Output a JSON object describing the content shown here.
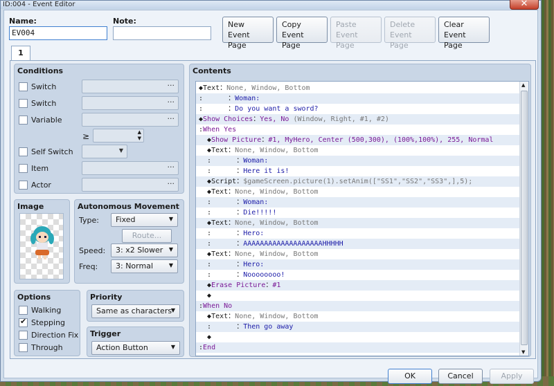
{
  "window": {
    "title": "ID:004 - Event Editor",
    "close": "✕"
  },
  "header": {
    "name_label": "Name:",
    "name_value": "EV004",
    "note_label": "Note:",
    "note_value": ""
  },
  "toolbar": [
    {
      "line1": "New",
      "line2": "Event Page"
    },
    {
      "line1": "Copy",
      "line2": "Event Page"
    },
    {
      "line1": "Paste",
      "line2": "Event Page"
    },
    {
      "line1": "Delete",
      "line2": "Event Page"
    },
    {
      "line1": "Clear",
      "line2": "Event Page"
    }
  ],
  "tab": {
    "label": "1"
  },
  "conditions": {
    "title": "Conditions",
    "items": [
      {
        "label": "Switch"
      },
      {
        "label": "Switch"
      },
      {
        "label": "Variable"
      },
      {
        "label": "Self Switch"
      },
      {
        "label": "Item"
      },
      {
        "label": "Actor"
      }
    ],
    "ge_symbol": "≥",
    "dots": "···"
  },
  "image": {
    "title": "Image"
  },
  "autonomous": {
    "title": "Autonomous Movement",
    "type_label": "Type:",
    "type_value": "Fixed",
    "route_label": "Route...",
    "speed_label": "Speed:",
    "speed_value": "3: x2 Slower",
    "freq_label": "Freq:",
    "freq_value": "3: Normal"
  },
  "options": {
    "title": "Options",
    "items": [
      {
        "label": "Walking",
        "checked": false
      },
      {
        "label": "Stepping",
        "checked": true
      },
      {
        "label": "Direction Fix",
        "checked": false
      },
      {
        "label": "Through",
        "checked": false
      }
    ]
  },
  "priority": {
    "title": "Priority",
    "value": "Same as characters"
  },
  "trigger": {
    "title": "Trigger",
    "value": "Action Button"
  },
  "contents": {
    "title": "Contents",
    "lines": [
      {
        "indent": "",
        "marker": "◆",
        "cmd": "Text",
        "sep": "：",
        "args": "None, Window, Bottom",
        "style": "gray"
      },
      {
        "indent": ":      ",
        "marker": "",
        "cmd": "",
        "sep": "：",
        "args": "Woman:",
        "style": "blue"
      },
      {
        "indent": ":      ",
        "marker": "",
        "cmd": "",
        "sep": "：",
        "args": "Do you want a sword?",
        "style": "blue"
      },
      {
        "indent": "",
        "marker": "◆",
        "cmd": "Show Choices",
        "sep": "：",
        "args": "Yes, No",
        "extra": " (Window, Right, #1, #2)",
        "style": "purple"
      },
      {
        "indent": ":",
        "marker": "",
        "cmd": "When Yes",
        "sep": "",
        "args": "",
        "style": "purple"
      },
      {
        "indent": "  ",
        "marker": "◆",
        "cmd": "Show Picture",
        "sep": "：",
        "args": "#1, MyHero, Center (500,300), (100%,100%), 255, Normal",
        "style": "purple"
      },
      {
        "indent": "  ",
        "marker": "◆",
        "cmd": "Text",
        "sep": "：",
        "args": "None, Window, Bottom",
        "style": "gray"
      },
      {
        "indent": "  :      ",
        "marker": "",
        "cmd": "",
        "sep": "：",
        "args": "Woman:",
        "style": "blue"
      },
      {
        "indent": "  :      ",
        "marker": "",
        "cmd": "",
        "sep": "：",
        "args": "Here it is!",
        "style": "blue"
      },
      {
        "indent": "  ",
        "marker": "◆",
        "cmd": "Script",
        "sep": "：",
        "args": "$gameScreen.picture(1).setAnim([\"SS1\",\"SS2\",\"SS3\",],5);",
        "style": "gray"
      },
      {
        "indent": "  ",
        "marker": "◆",
        "cmd": "Text",
        "sep": "：",
        "args": "None, Window, Bottom",
        "style": "gray"
      },
      {
        "indent": "  :      ",
        "marker": "",
        "cmd": "",
        "sep": "：",
        "args": "Woman:",
        "style": "blue"
      },
      {
        "indent": "  :      ",
        "marker": "",
        "cmd": "",
        "sep": "：",
        "args": "Die!!!!!",
        "style": "blue"
      },
      {
        "indent": "  ",
        "marker": "◆",
        "cmd": "Text",
        "sep": "：",
        "args": "None, Window, Bottom",
        "style": "gray"
      },
      {
        "indent": "  :      ",
        "marker": "",
        "cmd": "",
        "sep": "：",
        "args": "Hero:",
        "style": "blue"
      },
      {
        "indent": "  :      ",
        "marker": "",
        "cmd": "",
        "sep": "：",
        "args": "AAAAAAAAAAAAAAAAAAAHHHHH",
        "style": "blue"
      },
      {
        "indent": "  ",
        "marker": "◆",
        "cmd": "Text",
        "sep": "：",
        "args": "None, Window, Bottom",
        "style": "gray"
      },
      {
        "indent": "  :      ",
        "marker": "",
        "cmd": "",
        "sep": "：",
        "args": "Hero:",
        "style": "blue"
      },
      {
        "indent": "  :      ",
        "marker": "",
        "cmd": "",
        "sep": "：",
        "args": "Noooooooo!",
        "style": "blue"
      },
      {
        "indent": "  ",
        "marker": "◆",
        "cmd": "Erase Picture",
        "sep": "：",
        "args": "#1",
        "style": "purple"
      },
      {
        "indent": "  ",
        "marker": "◆",
        "cmd": "",
        "sep": "",
        "args": "",
        "style": "gray"
      },
      {
        "indent": ":",
        "marker": "",
        "cmd": "When No",
        "sep": "",
        "args": "",
        "style": "purple"
      },
      {
        "indent": "  ",
        "marker": "◆",
        "cmd": "Text",
        "sep": "：",
        "args": "None, Window, Bottom",
        "style": "gray"
      },
      {
        "indent": "  :      ",
        "marker": "",
        "cmd": "",
        "sep": "：",
        "args": "Then go away",
        "style": "blue"
      },
      {
        "indent": "  ",
        "marker": "◆",
        "cmd": "",
        "sep": "",
        "args": "",
        "style": "gray"
      },
      {
        "indent": ":",
        "marker": "",
        "cmd": "End",
        "sep": "",
        "args": "",
        "style": "purple"
      }
    ]
  },
  "footer": {
    "ok": "OK",
    "cancel": "Cancel",
    "apply": "Apply"
  }
}
